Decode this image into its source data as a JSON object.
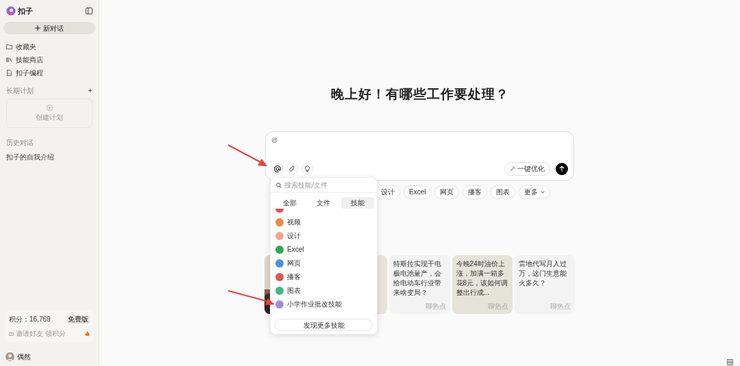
{
  "sidebar": {
    "brand": "扣子",
    "new_chat": "新对话",
    "nav": [
      {
        "label": "收藏夹"
      },
      {
        "label": "技能商店"
      },
      {
        "label": "扣子编程"
      }
    ],
    "plans": {
      "title": "长期计划",
      "add": "+",
      "create": "创建计划"
    },
    "history": {
      "title": "历史对话",
      "items": [
        "扣子的自我介绍"
      ]
    },
    "points": {
      "label": "积分：16,769",
      "badge": "免费版",
      "invite": "邀请好友 领积分"
    },
    "user": {
      "name": "偶然"
    }
  },
  "main": {
    "greeting": "晚上好！有哪些工作要处理？",
    "input": {
      "value": "@"
    },
    "optimize": "一键优化",
    "chips": [
      "设计",
      "Excel",
      "网页",
      "播客",
      "图表",
      "更多"
    ],
    "cards": [
      {
        "text": "特斯拉实现干电极电池量产，会给电动车行业带来啥变局？",
        "tag": "聊热点",
        "highlighted": false
      },
      {
        "text": "今晚24时油价上涨，加满一箱多花8元，该如何调整出行成...",
        "tag": "聊热点",
        "highlighted": true
      },
      {
        "text": "雷地代写月入过万，这门生意能火多久？",
        "tag": "聊热点",
        "highlighted": false
      }
    ]
  },
  "dropdown": {
    "search_placeholder": "搜索技能/文件",
    "tabs": [
      {
        "label": "全部",
        "selected": false
      },
      {
        "label": "文件",
        "selected": false
      },
      {
        "label": "技能",
        "selected": true
      }
    ],
    "items": [
      {
        "label": "视频",
        "color": "#f0883e"
      },
      {
        "label": "设计",
        "color": "#f2a58a"
      },
      {
        "label": "Excel",
        "color": "#2fa84f"
      },
      {
        "label": "网页",
        "color": "#4a90e2"
      },
      {
        "label": "播客",
        "color": "#e05555"
      },
      {
        "label": "图表",
        "color": "#3fb984"
      },
      {
        "label": "小学作业批改技能",
        "color": "#9c8fd6"
      }
    ],
    "more": "发现更多技能"
  }
}
